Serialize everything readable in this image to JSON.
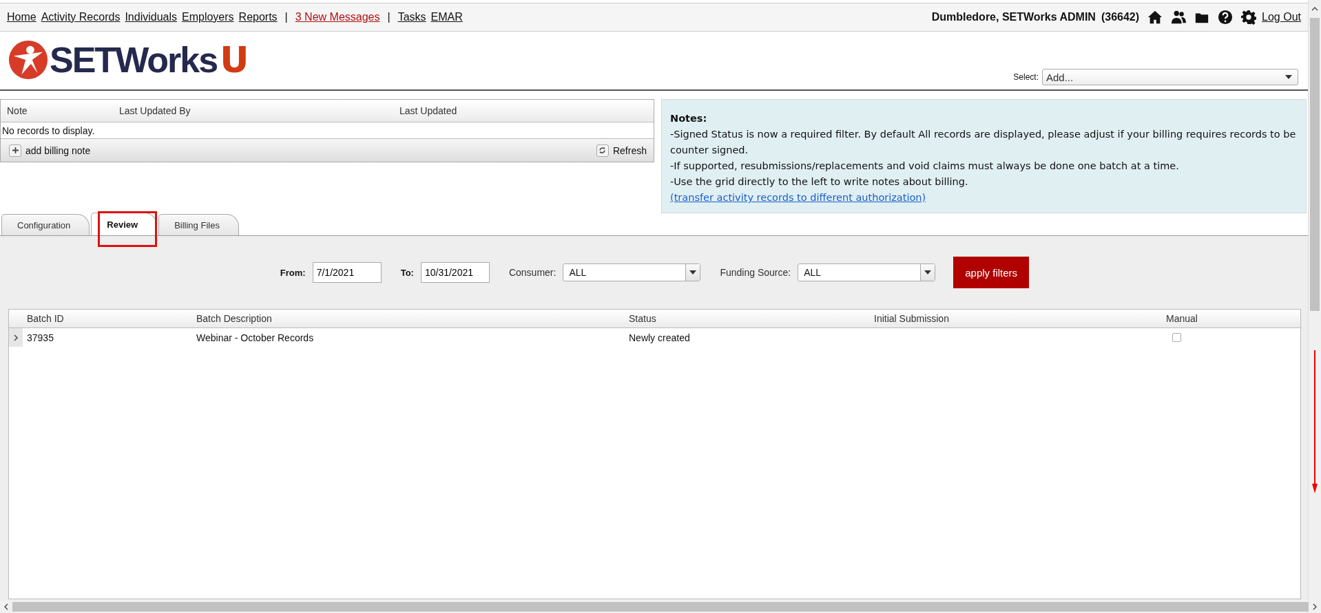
{
  "top_nav": [
    {
      "kind": "link",
      "label": "Home"
    },
    {
      "kind": "link",
      "label": "Activity Records"
    },
    {
      "kind": "link",
      "label": "Individuals"
    },
    {
      "kind": "link",
      "label": "Employers"
    },
    {
      "kind": "link",
      "label": "Reports"
    },
    {
      "kind": "separator",
      "label": "|"
    },
    {
      "kind": "alert",
      "label": "3 New Messages"
    },
    {
      "kind": "separator",
      "label": "|"
    },
    {
      "kind": "link",
      "label": "Tasks"
    },
    {
      "kind": "link",
      "label": "EMAR"
    }
  ],
  "user": {
    "name": "Dumbledore, SETWorks ADMIN",
    "id": "(36642)",
    "logout": "Log Out"
  },
  "logo": {
    "name": "SETWorks",
    "letter": "U"
  },
  "select": {
    "label": "Select:",
    "value": "Add..."
  },
  "notes_grid": {
    "columns": [
      "Note",
      "Last Updated By",
      "Last Updated"
    ],
    "empty_message": "No records to display.",
    "add_button": "add billing note",
    "refresh_button": "Refresh"
  },
  "notes_panel": {
    "title": "Notes:",
    "lines": [
      "-Signed Status is now a required filter. By default All records are displayed, please adjust if your billing requires records to be counter signed.",
      "-If supported, resubmissions/replacements and void claims must always be done one batch at a time.",
      "-Use the grid directly to the left to write notes about billing."
    ],
    "link": "(transfer activity records to different authorization)"
  },
  "tabs": [
    {
      "label": "Configuration",
      "selected": false,
      "highlighted": false
    },
    {
      "label": "Review",
      "selected": true,
      "highlighted": true
    },
    {
      "label": "Billing Files",
      "selected": false,
      "highlighted": false
    }
  ],
  "filters": {
    "from": {
      "label": "From:",
      "value": "7/1/2021"
    },
    "to": {
      "label": "To:",
      "value": "10/31/2021"
    },
    "consumer": {
      "label": "Consumer:",
      "value": "ALL"
    },
    "funding_source": {
      "label": "Funding Source:",
      "value": "ALL"
    },
    "apply_button": "apply filters"
  },
  "batches": {
    "columns": [
      "Batch ID",
      "Batch Description",
      "Status",
      "Initial Submission",
      "Manual"
    ],
    "rows": [
      {
        "batch_id": "37935",
        "description": "Webinar - October Records",
        "status": "Newly created",
        "manual": false
      }
    ]
  }
}
